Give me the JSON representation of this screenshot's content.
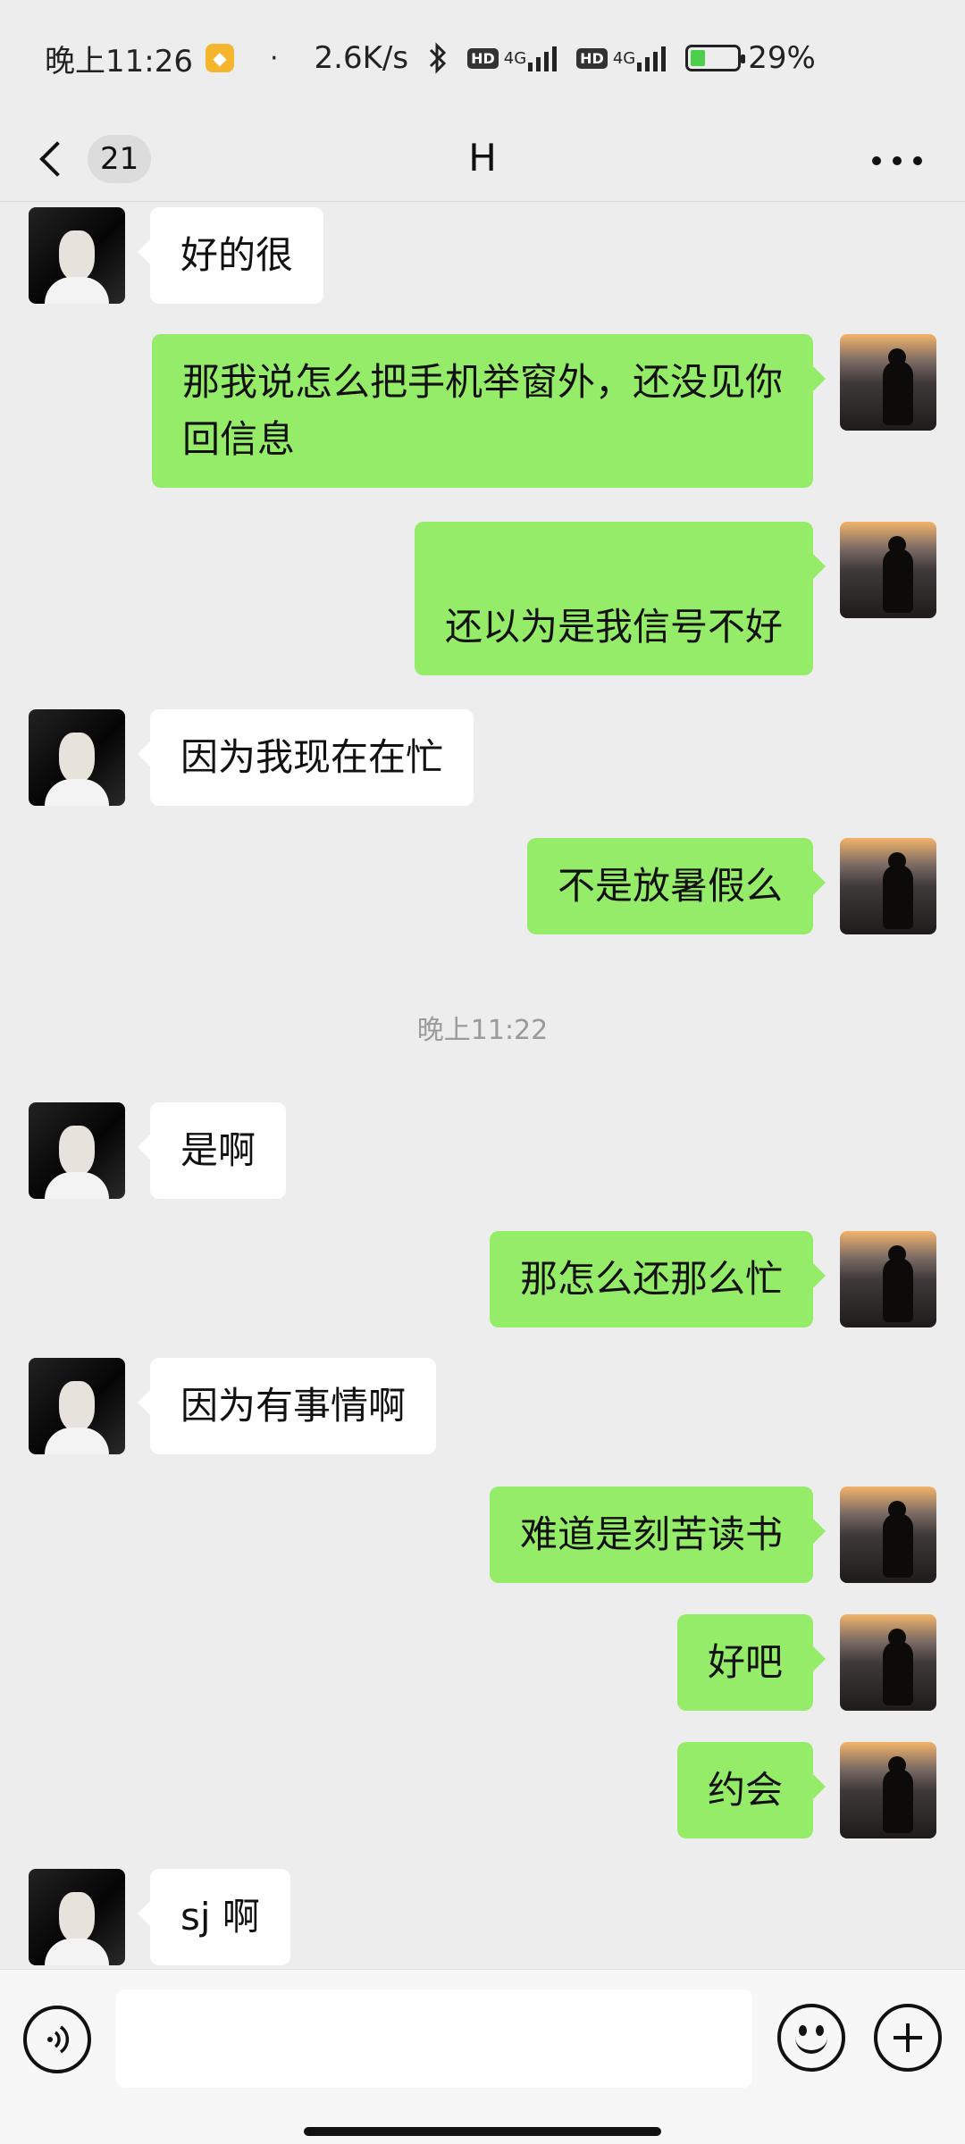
{
  "status_bar": {
    "time": "晚上11:26",
    "dot": "·",
    "net_speed": "2.6K/s",
    "hd1": "HD",
    "net1": "4G",
    "hd2": "HD",
    "net2": "4G",
    "battery": "29%",
    "icons": [
      "app-notification-icon",
      "bluetooth-icon",
      "signal-icon",
      "battery-charging-icon"
    ]
  },
  "header": {
    "unread_count": "21",
    "title": "H"
  },
  "messages": [
    {
      "side": "left",
      "text": "好的很"
    },
    {
      "side": "right",
      "text": "那我说怎么把手机举窗外，还没见你回信息"
    },
    {
      "side": "right",
      "text": "还以为是我信号不好"
    },
    {
      "side": "left",
      "text": "因为我现在在忙"
    },
    {
      "side": "right",
      "text": "不是放暑假么"
    },
    {
      "side": "left",
      "text": "是啊"
    },
    {
      "side": "right",
      "text": "那怎么还那么忙"
    },
    {
      "side": "left",
      "text": "因为有事情啊"
    },
    {
      "side": "right",
      "text": "难道是刻苦读书"
    },
    {
      "side": "right",
      "text": "好吧"
    },
    {
      "side": "right",
      "text": "约会"
    },
    {
      "side": "left",
      "text": "sj 啊"
    }
  ],
  "timestamp": "晚上11:22",
  "input": {
    "value": "",
    "placeholder": ""
  },
  "colors": {
    "background": "#ededed",
    "sent_bubble": "#95ec69",
    "received_bubble": "#ffffff",
    "timestamp_text": "#9a9a9a"
  }
}
